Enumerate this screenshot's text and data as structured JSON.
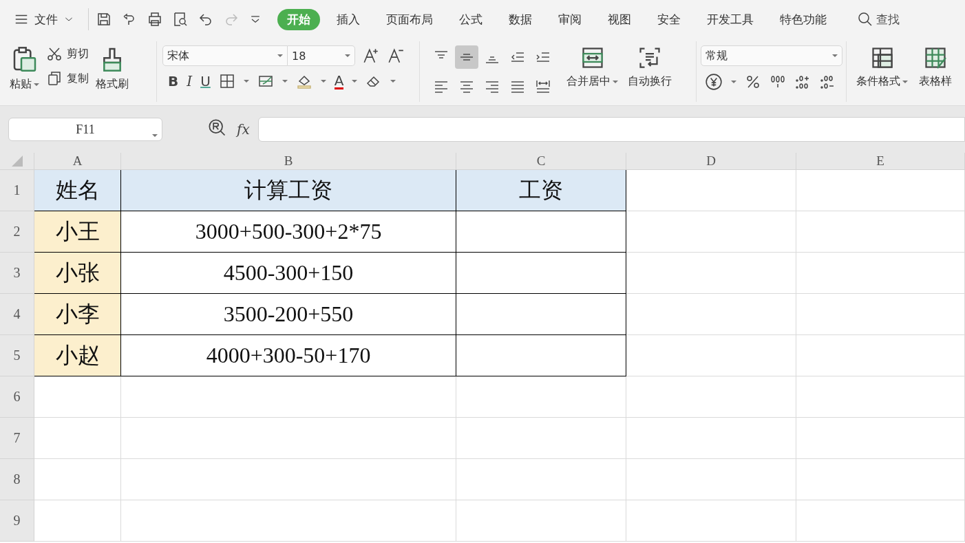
{
  "menu": {
    "label": "文件"
  },
  "tabs": [
    {
      "label": "开始",
      "selected": true
    },
    {
      "label": "插入",
      "selected": false
    },
    {
      "label": "页面布局",
      "selected": false
    },
    {
      "label": "公式",
      "selected": false
    },
    {
      "label": "数据",
      "selected": false
    },
    {
      "label": "审阅",
      "selected": false
    },
    {
      "label": "视图",
      "selected": false
    },
    {
      "label": "安全",
      "selected": false
    },
    {
      "label": "开发工具",
      "selected": false
    },
    {
      "label": "特色功能",
      "selected": false
    }
  ],
  "search": {
    "label": "查找"
  },
  "ribbon": {
    "paste": "粘贴",
    "cut": "剪切",
    "copy": "复制",
    "format_painter": "格式刷",
    "font_name": "宋体",
    "font_size": "18",
    "bold": "B",
    "italic": "I",
    "underline": "U",
    "font_color": "A",
    "align_buttons": [
      {
        "kind": "top",
        "selected": false
      },
      {
        "kind": "middle",
        "selected": true
      },
      {
        "kind": "bottom",
        "selected": false
      },
      {
        "kind": "outdent",
        "selected": false
      },
      {
        "kind": "indent",
        "selected": false
      },
      {
        "kind": "left",
        "selected": false
      },
      {
        "kind": "center",
        "selected": false
      },
      {
        "kind": "right",
        "selected": false
      },
      {
        "kind": "justify",
        "selected": false
      },
      {
        "kind": "distribute",
        "selected": false
      }
    ],
    "merge": "合并居中",
    "wrap": "自动换行",
    "number_format": "常规",
    "conditional_format": "条件格式",
    "table_style": "表格样"
  },
  "formula_bar": {
    "name_box": "F11",
    "fx": "fx"
  },
  "columns": [
    "A",
    "B",
    "C",
    "D",
    "E"
  ],
  "rows": [
    {
      "number": "1",
      "cells": [
        {
          "kind": "header",
          "text": "姓名"
        },
        {
          "kind": "header",
          "text": "计算工资"
        },
        {
          "kind": "header",
          "text": "工资"
        }
      ]
    },
    {
      "number": "2",
      "cells": [
        {
          "kind": "name",
          "text": "小王"
        },
        {
          "kind": "value",
          "text": "3000+500-300+2*75"
        },
        {
          "kind": "value"
        }
      ]
    },
    {
      "number": "3",
      "cells": [
        {
          "kind": "name",
          "text": "小张"
        },
        {
          "kind": "value",
          "text": "4500-300+150"
        },
        {
          "kind": "value"
        }
      ]
    },
    {
      "number": "4",
      "cells": [
        {
          "kind": "name",
          "text": "小李"
        },
        {
          "kind": "value",
          "text": "3500-200+550"
        },
        {
          "kind": "value"
        }
      ]
    },
    {
      "number": "5",
      "cells": [
        {
          "kind": "name",
          "text": "小赵"
        },
        {
          "kind": "value",
          "text": "4000+300-50+170"
        },
        {
          "kind": "value"
        }
      ]
    },
    {
      "number": "6",
      "cells": []
    },
    {
      "number": "7",
      "cells": []
    },
    {
      "number": "8",
      "cells": []
    },
    {
      "number": "9",
      "cells": []
    }
  ]
}
